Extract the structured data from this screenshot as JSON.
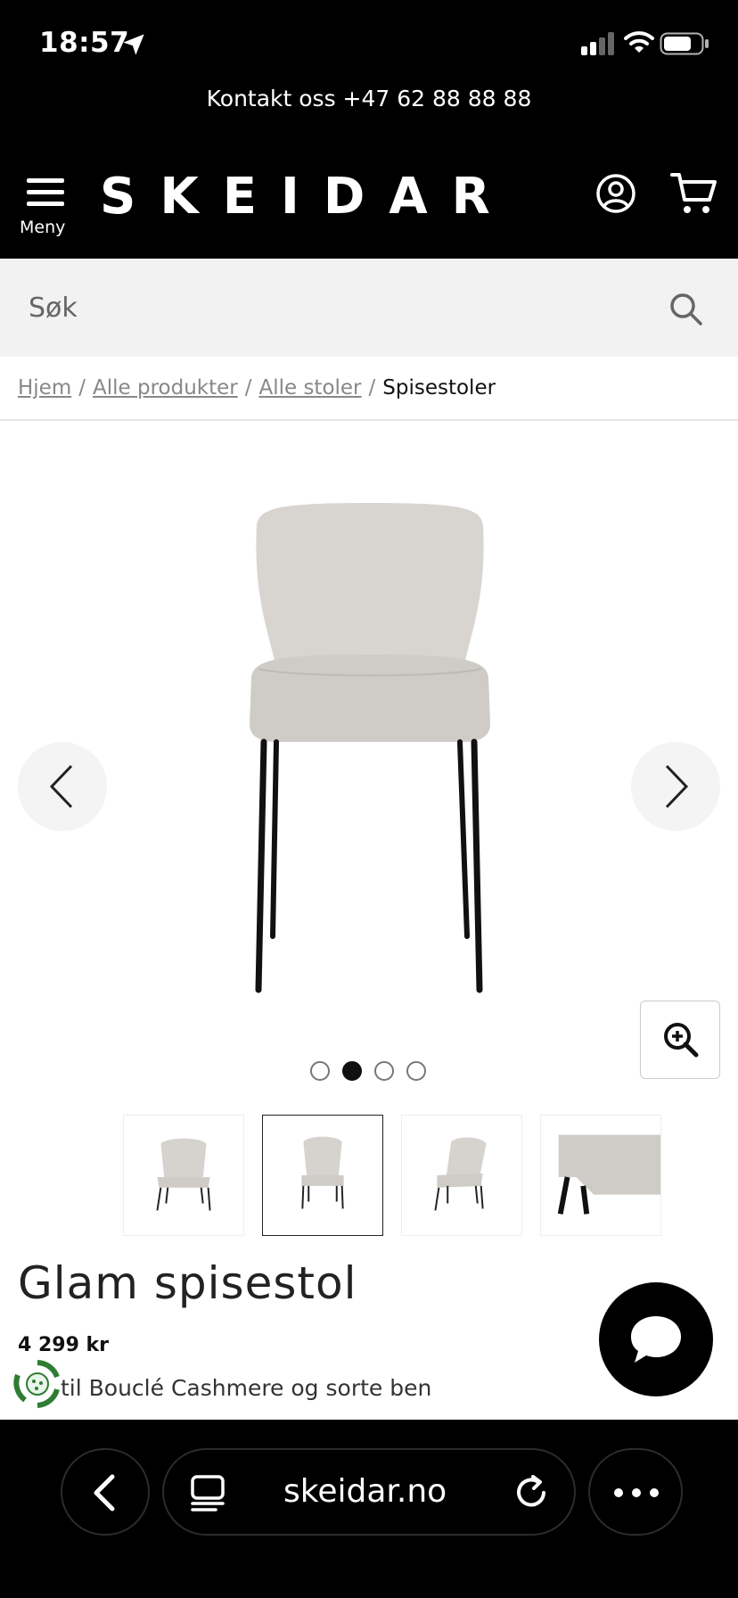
{
  "status_bar": {
    "time": "18:57"
  },
  "contact": {
    "text": "Kontakt oss +47 62 88 88 88"
  },
  "header": {
    "menu_label": "Meny",
    "logo": "SKEIDAR"
  },
  "search": {
    "placeholder": "Søk"
  },
  "breadcrumb": {
    "items": [
      "Hjem",
      "Alle produkter",
      "Alle stoler"
    ],
    "current": "Spisestoler",
    "separator": "/"
  },
  "gallery": {
    "image_count": 4,
    "active_index": 1
  },
  "product": {
    "title": "Glam spisestol",
    "price": "4 299 kr",
    "price_visible": "4 299 kr",
    "description": "Stil Bouclé Cashmere og sorte ben",
    "description_visible": "til Bouclé Cashmere og sorte ben"
  },
  "browser": {
    "url": "skeidar.no"
  },
  "colors": {
    "black": "#000000",
    "search_bg": "#f2f2f2",
    "chair_fabric": "#d8d5d1"
  },
  "icons": [
    "location-arrow-icon",
    "signal-icon",
    "wifi-icon",
    "battery-icon",
    "hamburger-icon",
    "account-icon",
    "cart-icon",
    "search-icon",
    "chevron-left-icon",
    "chevron-right-icon",
    "zoom-in-icon",
    "chat-icon",
    "eco-badge-icon",
    "tabs-icon",
    "reload-icon",
    "more-icon"
  ]
}
